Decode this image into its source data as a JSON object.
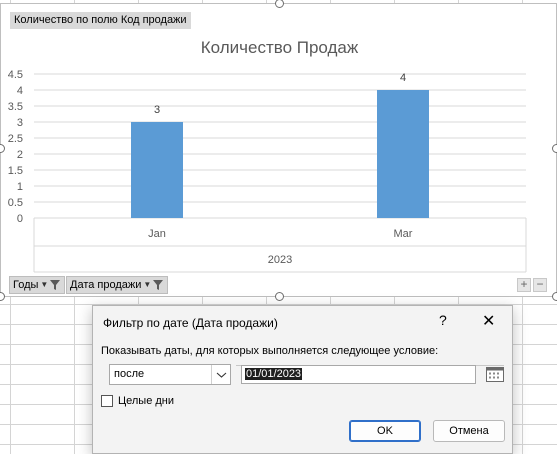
{
  "chart": {
    "field_tag": "Количество по полю Код продажи",
    "title": "Количество Продаж",
    "group_label": "2023",
    "bar_color": "#5b9bd5",
    "filter_buttons": [
      {
        "label": "Годы",
        "icon": "funnel-icon"
      },
      {
        "label": "Дата продажи",
        "icon": "funnel-icon"
      }
    ],
    "zoom_in": "+",
    "zoom_out": "−"
  },
  "chart_data": {
    "type": "bar",
    "title": "Количество Продаж",
    "categories": [
      "Jan",
      "Mar"
    ],
    "group": "2023",
    "values": [
      3,
      4
    ],
    "data_labels": [
      "3",
      "4"
    ],
    "ylim": [
      0,
      4.5
    ],
    "yticks": [
      "0",
      "0.5",
      "1",
      "1.5",
      "2",
      "2.5",
      "3",
      "3.5",
      "4",
      "4.5"
    ],
    "grid": true
  },
  "dialog": {
    "title": "Фильтр по дате (Дата продажи)",
    "help": "?",
    "close": "✕",
    "prompt": "Показывать даты, для которых выполняется следующее условие:",
    "condition_value": "после",
    "date_value": "01/01/2023",
    "whole_days_label": "Целые дни",
    "whole_days_checked": false,
    "ok_label": "OK",
    "cancel_label": "Отмена"
  }
}
